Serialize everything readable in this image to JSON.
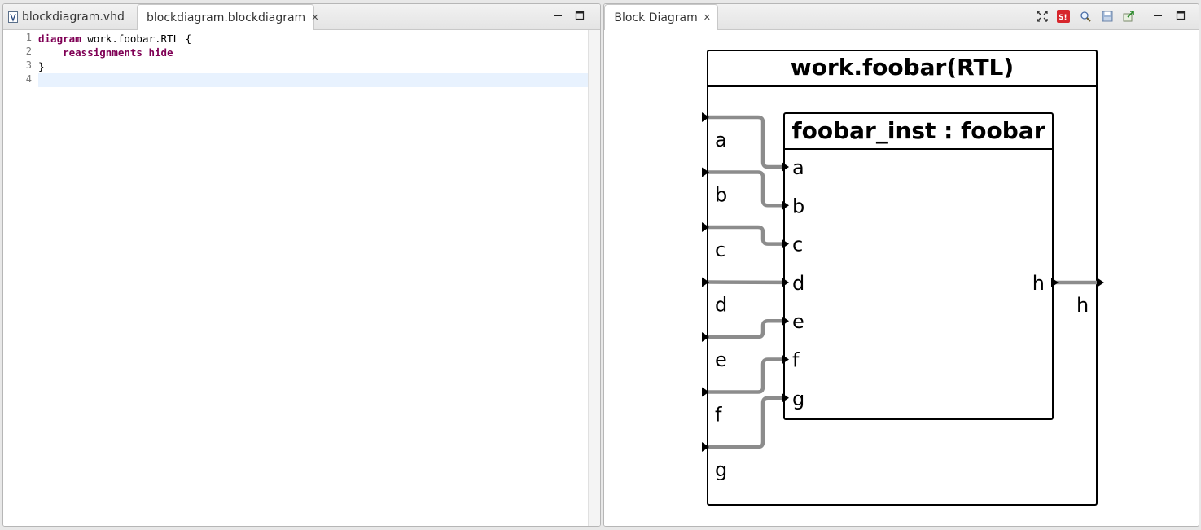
{
  "editor": {
    "tabs": [
      {
        "label": "blockdiagram.vhd",
        "icon": "vhdl-file-icon",
        "active": false
      },
      {
        "label": "blockdiagram.blockdiagram",
        "icon": "text-file-icon",
        "active": true
      }
    ],
    "lines": [
      {
        "num": "1",
        "kw1": "diagram",
        "rest1": " work.foobar.RTL {"
      },
      {
        "num": "2",
        "indent": "    ",
        "kw1": "reassignments",
        "mid": " ",
        "kw2": "hide"
      },
      {
        "num": "3",
        "text": "}"
      },
      {
        "num": "4",
        "text": ""
      }
    ]
  },
  "view": {
    "tab": {
      "label": "Block Diagram",
      "icon": "diagram-view-icon"
    },
    "toolbar_icons": [
      "fit-to-view-icon",
      "sigasi-icon",
      "zoom-icon",
      "save-icon",
      "export-icon",
      "minimize-icon",
      "maximize-icon"
    ]
  },
  "diagram": {
    "outer_title": "work.foobar(RTL)",
    "inner_title": "foobar_inst : foobar",
    "outer_inputs": [
      "a",
      "b",
      "c",
      "d",
      "e",
      "f",
      "g"
    ],
    "inner_inputs": [
      "a",
      "b",
      "c",
      "d",
      "e",
      "f",
      "g"
    ],
    "inner_output": "h",
    "outer_output": "h",
    "wire_color": "#8c8c8c",
    "border_color": "#000000"
  }
}
